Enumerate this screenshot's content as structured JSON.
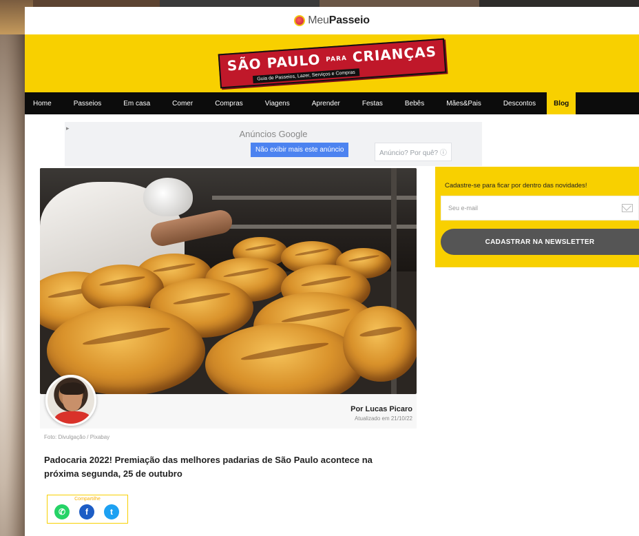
{
  "site": {
    "brand_light": "Meu",
    "brand_bold": "Passeio",
    "header_logo_main": "SÃO PAULO",
    "header_logo_para": "PARA",
    "header_logo_end": "CRIANÇAS",
    "header_logo_sub": "Guia de Passeios, Lazer, Serviços e Compras"
  },
  "nav": {
    "items": [
      {
        "label": "Home"
      },
      {
        "label": "Passeios"
      },
      {
        "label": "Em casa"
      },
      {
        "label": "Comer"
      },
      {
        "label": "Compras"
      },
      {
        "label": "Viagens"
      },
      {
        "label": "Aprender"
      },
      {
        "label": "Festas"
      },
      {
        "label": "Bebês"
      },
      {
        "label": "Mães&Pais"
      },
      {
        "label": "Descontos"
      },
      {
        "label": "Blog"
      }
    ],
    "active_index": 11
  },
  "ad": {
    "title": "Anúncios Google",
    "hide_button": "Não exibir mais este anúncio",
    "why_button": "Anúncio? Por quê? ⓘ",
    "marker": "▸"
  },
  "article": {
    "author": "Por Lucas Picaro",
    "updated": "Atualizado em 21/10/22",
    "photo_credit": "Foto: Divulgação / Pixabay",
    "headline": "Padocaria 2022! Premiação das melhores padarias de São Paulo acontece na próxima segunda, 25 de outubro",
    "share_label": "Compartilhe",
    "share_buttons": [
      {
        "icon": "whatsapp-icon",
        "glyph": "✆",
        "color": "#25d366"
      },
      {
        "icon": "facebook-icon",
        "glyph": "f",
        "color": "#1d5dc5"
      },
      {
        "icon": "twitter-icon",
        "glyph": "t",
        "color": "#1da1f2"
      }
    ]
  },
  "newsletter": {
    "title": "Cadastre-se para ficar por dentro das novidades!",
    "email_placeholder": "Seu e-mail",
    "button": "CADASTRAR NA NEWSLETTER"
  },
  "colors": {
    "brand_yellow": "#f8d000",
    "nav_bg": "#0c0c0c",
    "ad_button": "#4c83f0"
  }
}
